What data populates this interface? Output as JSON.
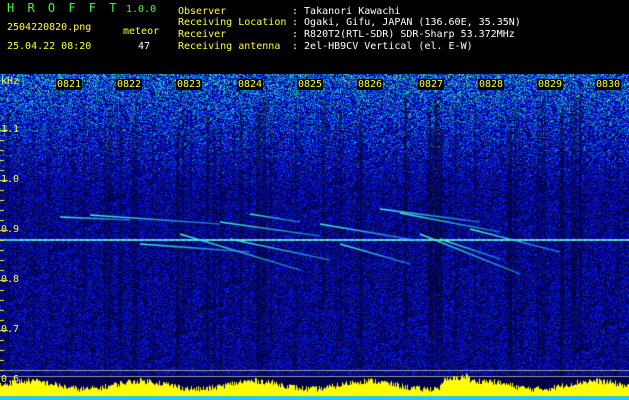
{
  "app": {
    "title": "H R O F F T",
    "version": "1.0.0"
  },
  "file": {
    "name": "2504220820.png",
    "datetime": "25.04.22 08:20"
  },
  "meteor": {
    "label": "meteor",
    "count": "47"
  },
  "station": [
    {
      "label": "Observer",
      "value": ": Takanori Kawachi"
    },
    {
      "label": "Receiving Location",
      "value": ": Ogaki, Gifu, JAPAN (136.60E, 35.35N)"
    },
    {
      "label": "Receiver",
      "value": ": R820T2(RTL-SDR) SDR-Sharp 53.372MHz"
    },
    {
      "label": "Receiving antenna",
      "value": ": 2el-HB9CV Vertical (el. E-W)"
    }
  ],
  "axis": {
    "unit": "kHz",
    "time_ticks": [
      "0821",
      "0822",
      "0823",
      "0824",
      "0825",
      "0826",
      "0827",
      "0828",
      "0829",
      "0830"
    ],
    "freq_ticks": [
      "1.1",
      "1.0",
      "0.9",
      "0.8",
      "0.7",
      "0.6"
    ]
  },
  "colors": {
    "header_green": "#3cff3c",
    "label_yellow": "#ffff3c",
    "text_white": "#ffffff",
    "signal_cyan": "#30e0ff",
    "noise_blue": "#0a1a8c",
    "level_bar": "#ffff00"
  }
}
